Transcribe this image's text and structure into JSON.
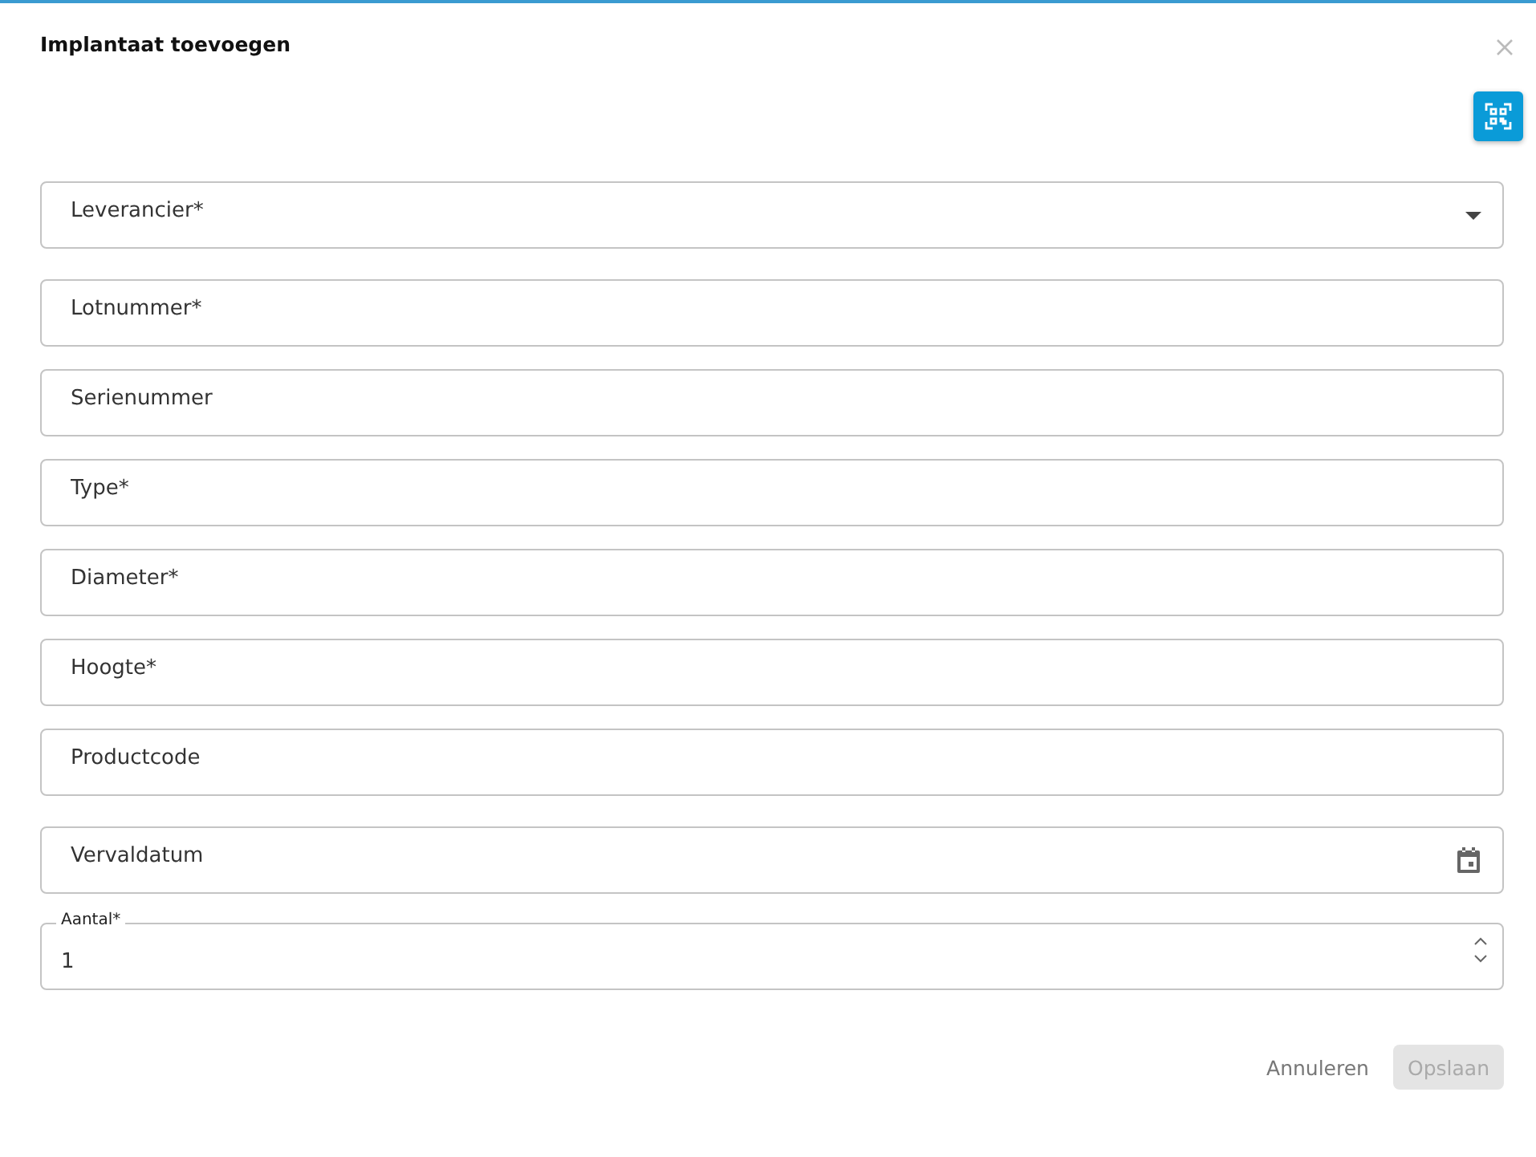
{
  "dialog": {
    "title": "Implantaat toevoegen"
  },
  "fields": [
    {
      "kind": "select",
      "placeholder": "Leverancier*"
    },
    {
      "kind": "text",
      "placeholder": "Lotnummer*"
    },
    {
      "kind": "text",
      "placeholder": "Serienummer"
    },
    {
      "kind": "text",
      "placeholder": "Type*"
    },
    {
      "kind": "text",
      "placeholder": "Diameter*"
    },
    {
      "kind": "text",
      "placeholder": "Hoogte*"
    },
    {
      "kind": "text",
      "placeholder": "Productcode"
    },
    {
      "kind": "date",
      "placeholder": "Vervaldatum"
    },
    {
      "kind": "number",
      "label": "Aantal*",
      "value": "1"
    }
  ],
  "buttons": [
    {
      "label": "Annuleren",
      "disabled": false
    },
    {
      "label": "Opslaan",
      "disabled": true
    }
  ]
}
